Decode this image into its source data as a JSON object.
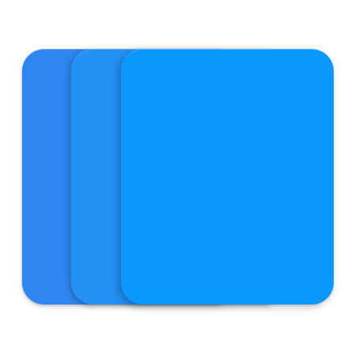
{
  "icon": {
    "name": "stacked-cards-icon",
    "colors": {
      "back": "#2F86EE",
      "middle": "#2491F6",
      "front": "#0A98FC"
    }
  }
}
